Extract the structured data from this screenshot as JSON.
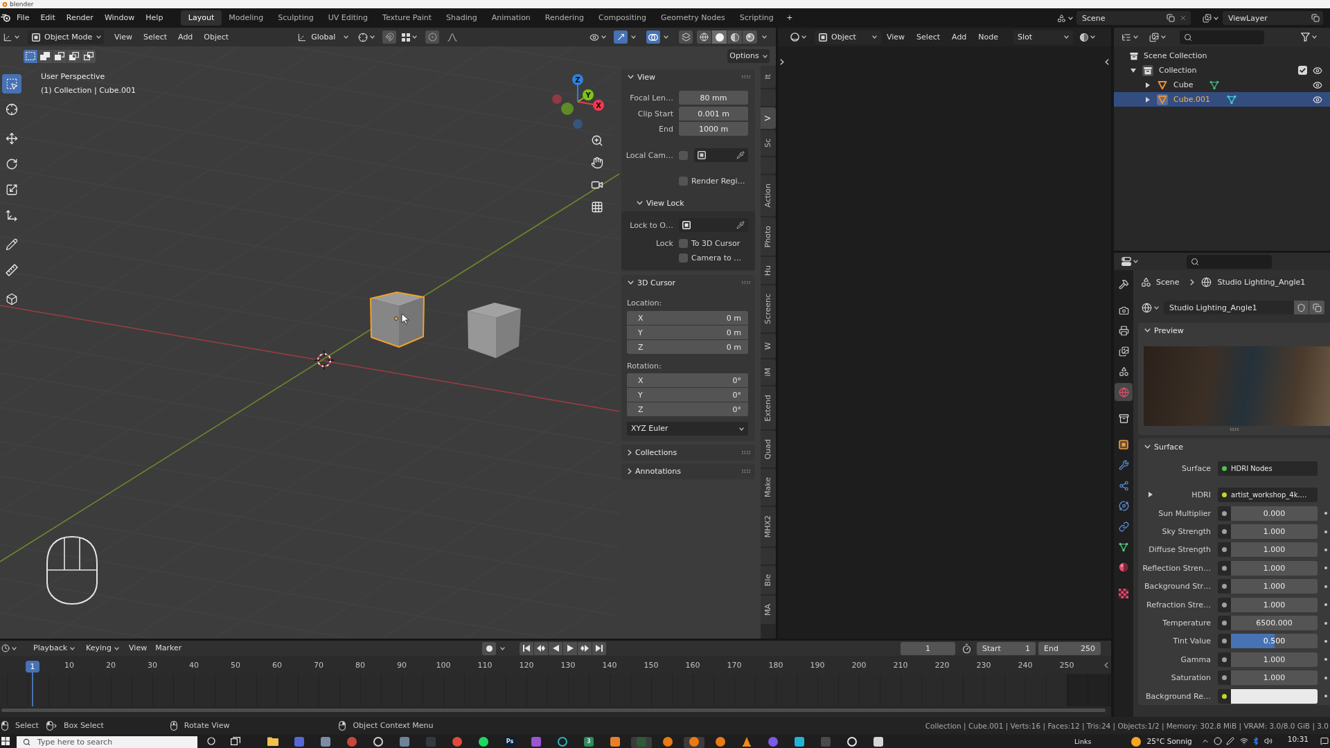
{
  "window": {
    "title": "blender"
  },
  "topbar": {
    "menus": [
      "File",
      "Edit",
      "Render",
      "Window",
      "Help"
    ],
    "workspaces": [
      {
        "label": "Layout",
        "selected": true
      },
      {
        "label": "Modeling",
        "selected": false
      },
      {
        "label": "Sculpting",
        "selected": false
      },
      {
        "label": "UV Editing",
        "selected": false
      },
      {
        "label": "Texture Paint",
        "selected": false
      },
      {
        "label": "Shading",
        "selected": false
      },
      {
        "label": "Animation",
        "selected": false
      },
      {
        "label": "Rendering",
        "selected": false
      },
      {
        "label": "Compositing",
        "selected": false
      },
      {
        "label": "Geometry Nodes",
        "selected": false
      },
      {
        "label": "Scripting",
        "selected": false
      }
    ],
    "add_workspace": "+",
    "scene": "Scene",
    "view_layer": "ViewLayer"
  },
  "viewport": {
    "header": {
      "mode": "Object Mode",
      "menus": [
        "View",
        "Select",
        "Add",
        "Object"
      ],
      "orientation": "Global",
      "snap": false,
      "proportional": false,
      "gizmos": true,
      "overlays": true,
      "xray": false,
      "shading": [
        {
          "kind": "wireframe",
          "selected": false
        },
        {
          "kind": "solid",
          "selected": true
        },
        {
          "kind": "material",
          "selected": false
        },
        {
          "kind": "rendered",
          "selected": false
        }
      ]
    },
    "select_modes": [
      {
        "kind": "set",
        "selected": true
      },
      {
        "kind": "extend",
        "selected": false
      },
      {
        "kind": "subtract",
        "selected": false
      },
      {
        "kind": "invert",
        "selected": false
      },
      {
        "kind": "intersect",
        "selected": false
      }
    ],
    "options": "Options",
    "toolbar": [
      [
        {
          "kind": "select_box",
          "selected": true
        },
        {
          "kind": "cursor",
          "selected": false
        }
      ],
      [
        {
          "kind": "move",
          "selected": false
        },
        {
          "kind": "rotate",
          "selected": false
        },
        {
          "kind": "scale",
          "selected": false
        },
        {
          "kind": "transform",
          "selected": false
        }
      ],
      [
        {
          "kind": "annotate",
          "selected": false
        },
        {
          "kind": "measure",
          "selected": false
        }
      ],
      [
        {
          "kind": "add_cube",
          "selected": false
        }
      ]
    ],
    "info": [
      "User Perspective",
      "(1) Collection | Cube.001"
    ],
    "gizmo_axes": [
      "X",
      "Y",
      "Z"
    ],
    "objects": [
      {
        "selected": true
      },
      {
        "selected": false
      }
    ],
    "sidebar": {
      "panels": [
        {
          "kind": "view",
          "title": "View",
          "expanded": true,
          "fields": [
            {
              "label": "Focal Len…",
              "value": "80 mm"
            },
            {
              "label": "Clip Start",
              "value": "0.001 m"
            },
            {
              "label": "End",
              "value": "1000 m"
            }
          ],
          "local_camera": {
            "label": "Local Cam…",
            "checked": false
          },
          "render_region": {
            "label": "Render Regi…",
            "checked": false
          },
          "view_lock": {
            "title": "View Lock",
            "expanded": true,
            "lock_object_label": "Lock to O…",
            "lock_label": "Lock",
            "locks": [
              {
                "label": "To 3D Cursor",
                "checked": false
              },
              {
                "label": "Camera to …",
                "checked": false
              }
            ]
          }
        },
        {
          "kind": "cursor",
          "title": "3D Cursor",
          "expanded": true,
          "location_label": "Location:",
          "location": [
            {
              "axis": "X",
              "value": "0 m"
            },
            {
              "axis": "Y",
              "value": "0 m"
            },
            {
              "axis": "Z",
              "value": "0 m"
            }
          ],
          "rotation_label": "Rotation:",
          "rotation": [
            {
              "axis": "X",
              "value": "0°"
            },
            {
              "axis": "Y",
              "value": "0°"
            },
            {
              "axis": "Z",
              "value": "0°"
            }
          ],
          "rotation_mode": "XYZ Euler"
        },
        {
          "kind": "collapsed",
          "title": "Collections",
          "expanded": false
        },
        {
          "kind": "collapsed",
          "title": "Annotations",
          "expanded": false
        }
      ]
    },
    "sidebar_tabs": [
      {
        "kind": "text",
        "label": "It",
        "selected": false
      },
      {
        "kind": "blank",
        "selected": false
      },
      {
        "kind": "text",
        "label": "V",
        "selected": true
      },
      {
        "kind": "text",
        "label": "Sc",
        "selected": false
      },
      {
        "kind": "blank",
        "selected": false
      },
      {
        "kind": "text",
        "label": "Action",
        "selected": false
      },
      {
        "kind": "text",
        "label": "Photo",
        "selected": false
      },
      {
        "kind": "text",
        "label": "Hu",
        "selected": false
      },
      {
        "kind": "text",
        "label": "Screenc",
        "selected": false
      },
      {
        "kind": "text",
        "label": "W",
        "selected": false
      },
      {
        "kind": "text",
        "label": "iM",
        "selected": false
      },
      {
        "kind": "text",
        "label": "Extend",
        "selected": false
      },
      {
        "kind": "text",
        "label": "Quad",
        "selected": false
      },
      {
        "kind": "text",
        "label": "Make",
        "selected": false
      },
      {
        "kind": "text",
        "label": "MHX2",
        "selected": false
      },
      {
        "kind": "blank",
        "selected": false
      },
      {
        "kind": "text",
        "label": "Ble",
        "selected": false
      },
      {
        "kind": "text",
        "label": "MA",
        "selected": false
      }
    ]
  },
  "node_editor": {
    "object_type": "Object",
    "menus": [
      "View",
      "Select",
      "Add",
      "Node"
    ],
    "slot": "Slot"
  },
  "outliner": {
    "tree": [
      {
        "kind": "scene_collection",
        "name": "Scene Collection",
        "selected": false,
        "children": [
          {
            "kind": "collection",
            "name": "Collection",
            "selected": false,
            "expanded": true,
            "checked": true,
            "visible": true,
            "children": [
              {
                "kind": "object",
                "name": "Cube",
                "selected": false,
                "expanded": false,
                "visible": true
              },
              {
                "kind": "object",
                "name": "Cube.001",
                "selected": true,
                "expanded": false,
                "visible": true
              }
            ]
          }
        ]
      }
    ]
  },
  "properties": {
    "tabs": [
      [
        {
          "kind": "tool",
          "selected": false
        }
      ],
      [
        {
          "kind": "render",
          "selected": false
        },
        {
          "kind": "output",
          "selected": false
        },
        {
          "kind": "view_layer",
          "selected": false
        },
        {
          "kind": "scene",
          "selected": false
        },
        {
          "kind": "world",
          "selected": true
        }
      ],
      [
        {
          "kind": "collection",
          "selected": false
        }
      ],
      [
        {
          "kind": "object",
          "selected": false
        },
        {
          "kind": "modifiers",
          "selected": false
        },
        {
          "kind": "particles",
          "selected": false
        },
        {
          "kind": "physics",
          "selected": false
        },
        {
          "kind": "constraints",
          "selected": false
        },
        {
          "kind": "data",
          "selected": false
        },
        {
          "kind": "material",
          "selected": false
        }
      ],
      [
        {
          "kind": "texture",
          "selected": false
        }
      ]
    ],
    "breadcrumb": [
      "Scene",
      "Studio Lighting_Angle1"
    ],
    "world": "Studio Lighting_Angle1",
    "preview": {
      "title": "Preview",
      "expanded": true
    },
    "surface": {
      "title": "Surface",
      "expanded": true,
      "rows": [
        {
          "kind": "link",
          "label": "Surface",
          "value": "HDRI Nodes",
          "color": "#4ec24e"
        },
        {
          "kind": "expandable_link",
          "label": "HDRI",
          "value": "artist_workshop_4k.…",
          "color": "#c8d42a",
          "expanded": false
        },
        {
          "kind": "number",
          "label": "Sun Multiplier",
          "value": "0.000",
          "color": "#a0a0a0"
        },
        {
          "kind": "number",
          "label": "Sky Strength",
          "value": "1.000",
          "color": "#a0a0a0"
        },
        {
          "kind": "number",
          "label": "Diffuse Strength",
          "value": "1.000",
          "color": "#a0a0a0"
        },
        {
          "kind": "number",
          "label": "Reflection Stren…",
          "value": "1.000",
          "color": "#a0a0a0"
        },
        {
          "kind": "number",
          "label": "Background Str…",
          "value": "1.000",
          "color": "#a0a0a0"
        },
        {
          "kind": "number",
          "label": "Refraction Stre…",
          "value": "1.000",
          "color": "#a0a0a0"
        },
        {
          "kind": "number",
          "label": "Temperature",
          "value": "6500.000",
          "color": "#a0a0a0"
        },
        {
          "kind": "slider",
          "label": "Tint Value",
          "value": "0.500",
          "level": 0.5,
          "color": "#a0a0a0"
        },
        {
          "kind": "number",
          "label": "Gamma",
          "value": "1.000",
          "color": "#a0a0a0"
        },
        {
          "kind": "number",
          "label": "Saturation",
          "value": "1.000",
          "color": "#a0a0a0"
        },
        {
          "kind": "swatch",
          "label": "Background Re…",
          "color": "#c8d42a",
          "swatch": {
            "color": "#eaeaea"
          }
        }
      ]
    }
  },
  "timeline": {
    "menus": [
      {
        "kind": "dropdown",
        "label": "Playback"
      },
      {
        "kind": "dropdown",
        "label": "Keying"
      },
      {
        "kind": "menu",
        "label": "View"
      },
      {
        "kind": "menu",
        "label": "Marker"
      }
    ],
    "auto_keying": false,
    "current_frame": "1",
    "start_label": "Start",
    "start": "1",
    "end_label": "End",
    "end": "250",
    "playhead": "1",
    "ruler": [
      "10",
      "20",
      "30",
      "40",
      "50",
      "60",
      "70",
      "80",
      "90",
      "100",
      "110",
      "120",
      "130",
      "140",
      "150",
      "160",
      "170",
      "180",
      "190",
      "200",
      "210",
      "220",
      "230",
      "240",
      "250"
    ]
  },
  "status_bar": {
    "hints": [
      {
        "kind": "left_click",
        "label": "Select"
      },
      {
        "kind": "drag",
        "label": "Box Select"
      },
      {
        "kind": "middle",
        "label": "Rotate View"
      },
      {
        "kind": "right_click",
        "label": "Object Context Menu"
      }
    ],
    "stats": "Collection | Cube.001 | Verts:16 | Faces:12 | Tris:24 | Objects:1/2 | Memory: 302.8 MiB | VRAM: 3.0/8.0 GiB | 3.0"
  },
  "taskbar": {
    "search": {
      "placeholder": "Type here to search"
    },
    "apps": [
      {
        "kind": "folder",
        "color": "#f2c14e",
        "active": false
      },
      {
        "kind": "tile",
        "color": "#5866d8",
        "active": false
      },
      {
        "kind": "tile",
        "color": "#7b8da5",
        "active": false
      },
      {
        "kind": "round",
        "color": "#c8463c",
        "active": false
      },
      {
        "kind": "ring",
        "color": "#d0d0d0",
        "active": false
      },
      {
        "kind": "tile",
        "color": "#6f8399",
        "active": false
      },
      {
        "kind": "tile",
        "color": "#34383f",
        "active": false
      },
      {
        "kind": "round",
        "color": "#dd4b3e",
        "active": false
      },
      {
        "kind": "round",
        "color": "#1ed760",
        "active": false
      },
      {
        "kind": "lettered",
        "color": "#0a1e36",
        "text": "Ps",
        "active": false
      },
      {
        "kind": "tile",
        "color": "#9a55d6",
        "active": false
      },
      {
        "kind": "ring",
        "color": "#2fb3c2",
        "active": false
      },
      {
        "kind": "lettered",
        "color": "#2e8c58",
        "text": "3",
        "active": false
      },
      {
        "kind": "tile",
        "color": "#e8802a",
        "active": false
      },
      {
        "kind": "tile",
        "color": "#2f5a35",
        "active": true
      },
      {
        "kind": "round",
        "color": "#ea7a12",
        "active": false
      },
      {
        "kind": "round",
        "color": "#ea7a12",
        "active": true
      },
      {
        "kind": "round",
        "color": "#ea7a12",
        "active": false
      },
      {
        "kind": "cone",
        "color": "#f08a12",
        "active": false
      },
      {
        "kind": "round",
        "color": "#7a5ae6",
        "active": false
      },
      {
        "kind": "tile",
        "color": "#22b4d6",
        "active": false
      },
      {
        "kind": "tile",
        "color": "#4a4a4a",
        "active": false
      },
      {
        "kind": "ring",
        "color": "#e8e8e8",
        "active": false
      },
      {
        "kind": "tile",
        "color": "#d6d6d6",
        "active": false
      }
    ],
    "links": "Links",
    "weather": "25°C Sonnig",
    "time": "10:31"
  }
}
